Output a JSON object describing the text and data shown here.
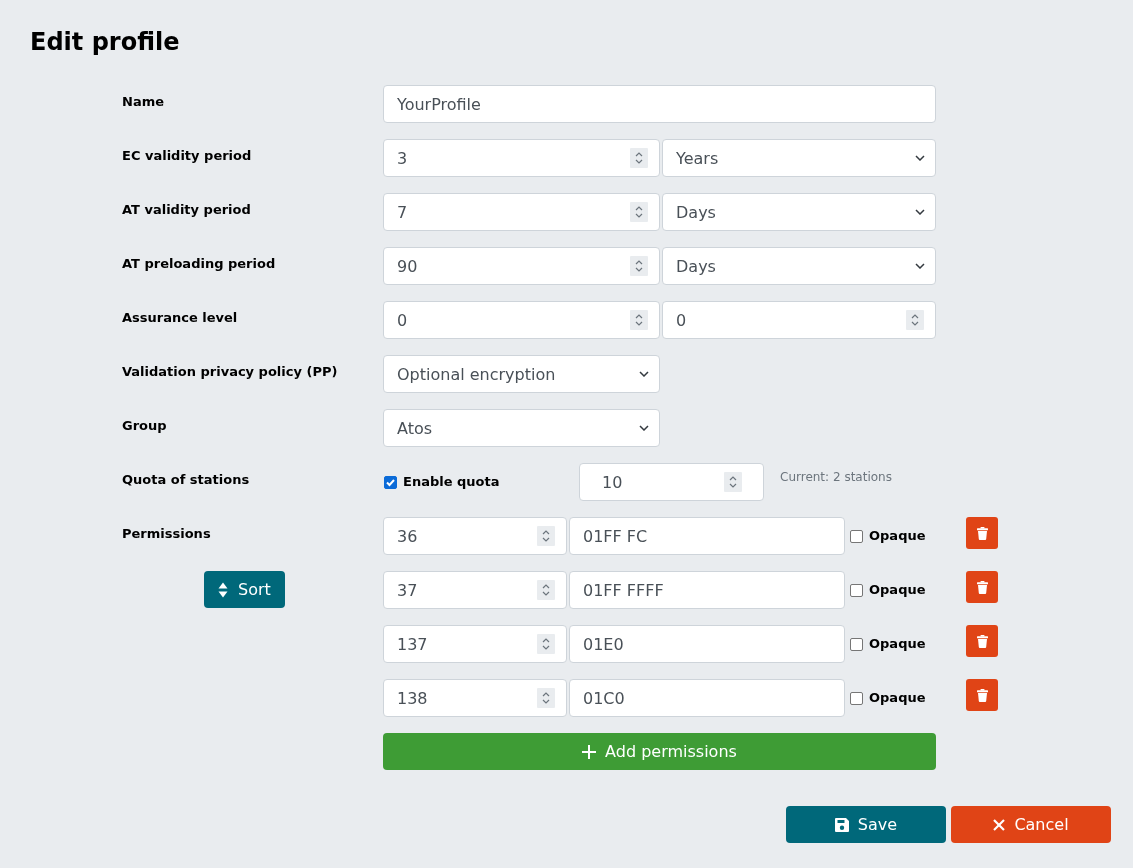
{
  "title": "Edit profile",
  "fields": [
    {
      "label": "Name",
      "kind": "wide",
      "controls": [
        {
          "kind": "text",
          "value": "YourProfile"
        }
      ]
    },
    {
      "label": "EC validity period",
      "kind": "pair",
      "controls": [
        {
          "kind": "number",
          "value": "3"
        },
        {
          "kind": "select",
          "value": "Years"
        }
      ]
    },
    {
      "label": "AT validity period",
      "kind": "pair",
      "controls": [
        {
          "kind": "number",
          "value": "7"
        },
        {
          "kind": "select",
          "value": "Days"
        }
      ]
    },
    {
      "label": "AT preloading period",
      "kind": "pair",
      "controls": [
        {
          "kind": "number",
          "value": "90"
        },
        {
          "kind": "select",
          "value": "Days"
        }
      ]
    },
    {
      "label": "Assurance level",
      "kind": "pair",
      "controls": [
        {
          "kind": "number",
          "value": "0"
        },
        {
          "kind": "number",
          "value": "0"
        }
      ]
    },
    {
      "label": "Validation privacy policy (PP)",
      "kind": "single",
      "controls": [
        {
          "kind": "select",
          "value": "Optional encryption"
        }
      ]
    },
    {
      "label": "Group",
      "kind": "single",
      "controls": [
        {
          "kind": "select",
          "value": "Atos"
        }
      ]
    },
    {
      "label": "Quota of stations",
      "kind": "quota",
      "controls": [
        {
          "kind": "checkbox",
          "label": "Enable quota",
          "checked": true
        },
        {
          "kind": "number",
          "value": "10"
        },
        {
          "kind": "note",
          "text": "Current: 2 stations"
        }
      ]
    }
  ],
  "permissions": {
    "label": "Permissions",
    "sort_button": "Sort",
    "rows": [
      {
        "number": "36",
        "value": "01FF FC",
        "opaque": {
          "label": "Opaque",
          "checked": false
        }
      },
      {
        "number": "37",
        "value": "01FF FFFF",
        "opaque": {
          "label": "Opaque",
          "checked": false
        }
      },
      {
        "number": "137",
        "value": "01E0",
        "opaque": {
          "label": "Opaque",
          "checked": false
        }
      },
      {
        "number": "138",
        "value": "01C0",
        "opaque": {
          "label": "Opaque",
          "checked": false
        }
      }
    ],
    "add_button": "Add permissions"
  },
  "buttons": [
    {
      "kind": "save",
      "label": "Save"
    },
    {
      "kind": "cancel",
      "label": "Cancel"
    }
  ]
}
